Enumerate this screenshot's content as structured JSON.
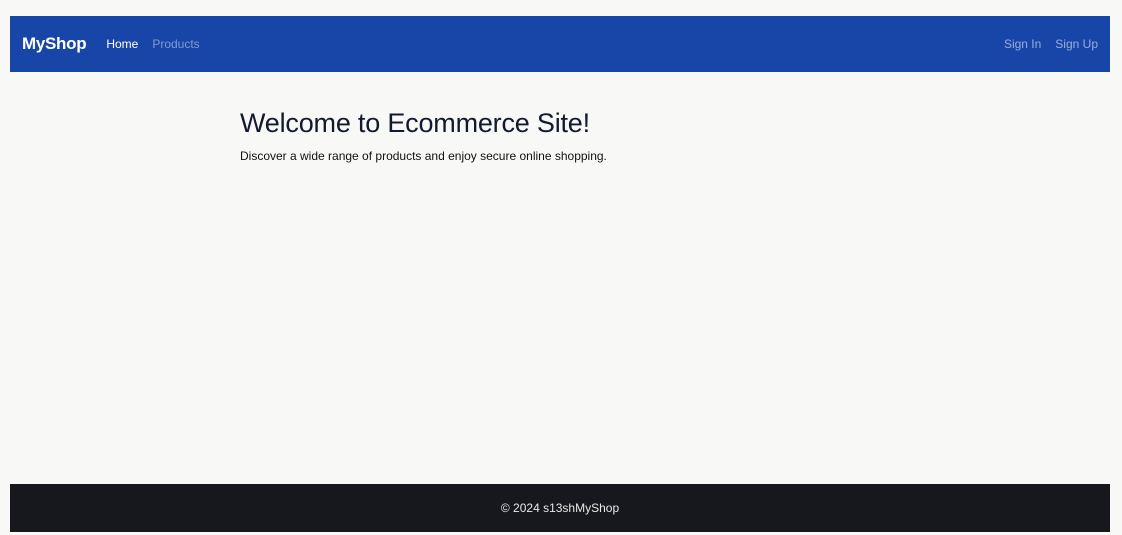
{
  "navbar": {
    "brand": "MyShop",
    "links": [
      {
        "label": "Home"
      },
      {
        "label": "Products"
      }
    ],
    "right_links": [
      {
        "label": "Sign In"
      },
      {
        "label": "Sign Up"
      }
    ],
    "background_color": "#1846a8"
  },
  "main": {
    "heading": "Welcome to Ecommerce Site!",
    "subtext": "Discover a wide range of products and enjoy secure online shopping."
  },
  "footer": {
    "text": "© 2024 s13shMyShop",
    "background_color": "#17181d"
  }
}
